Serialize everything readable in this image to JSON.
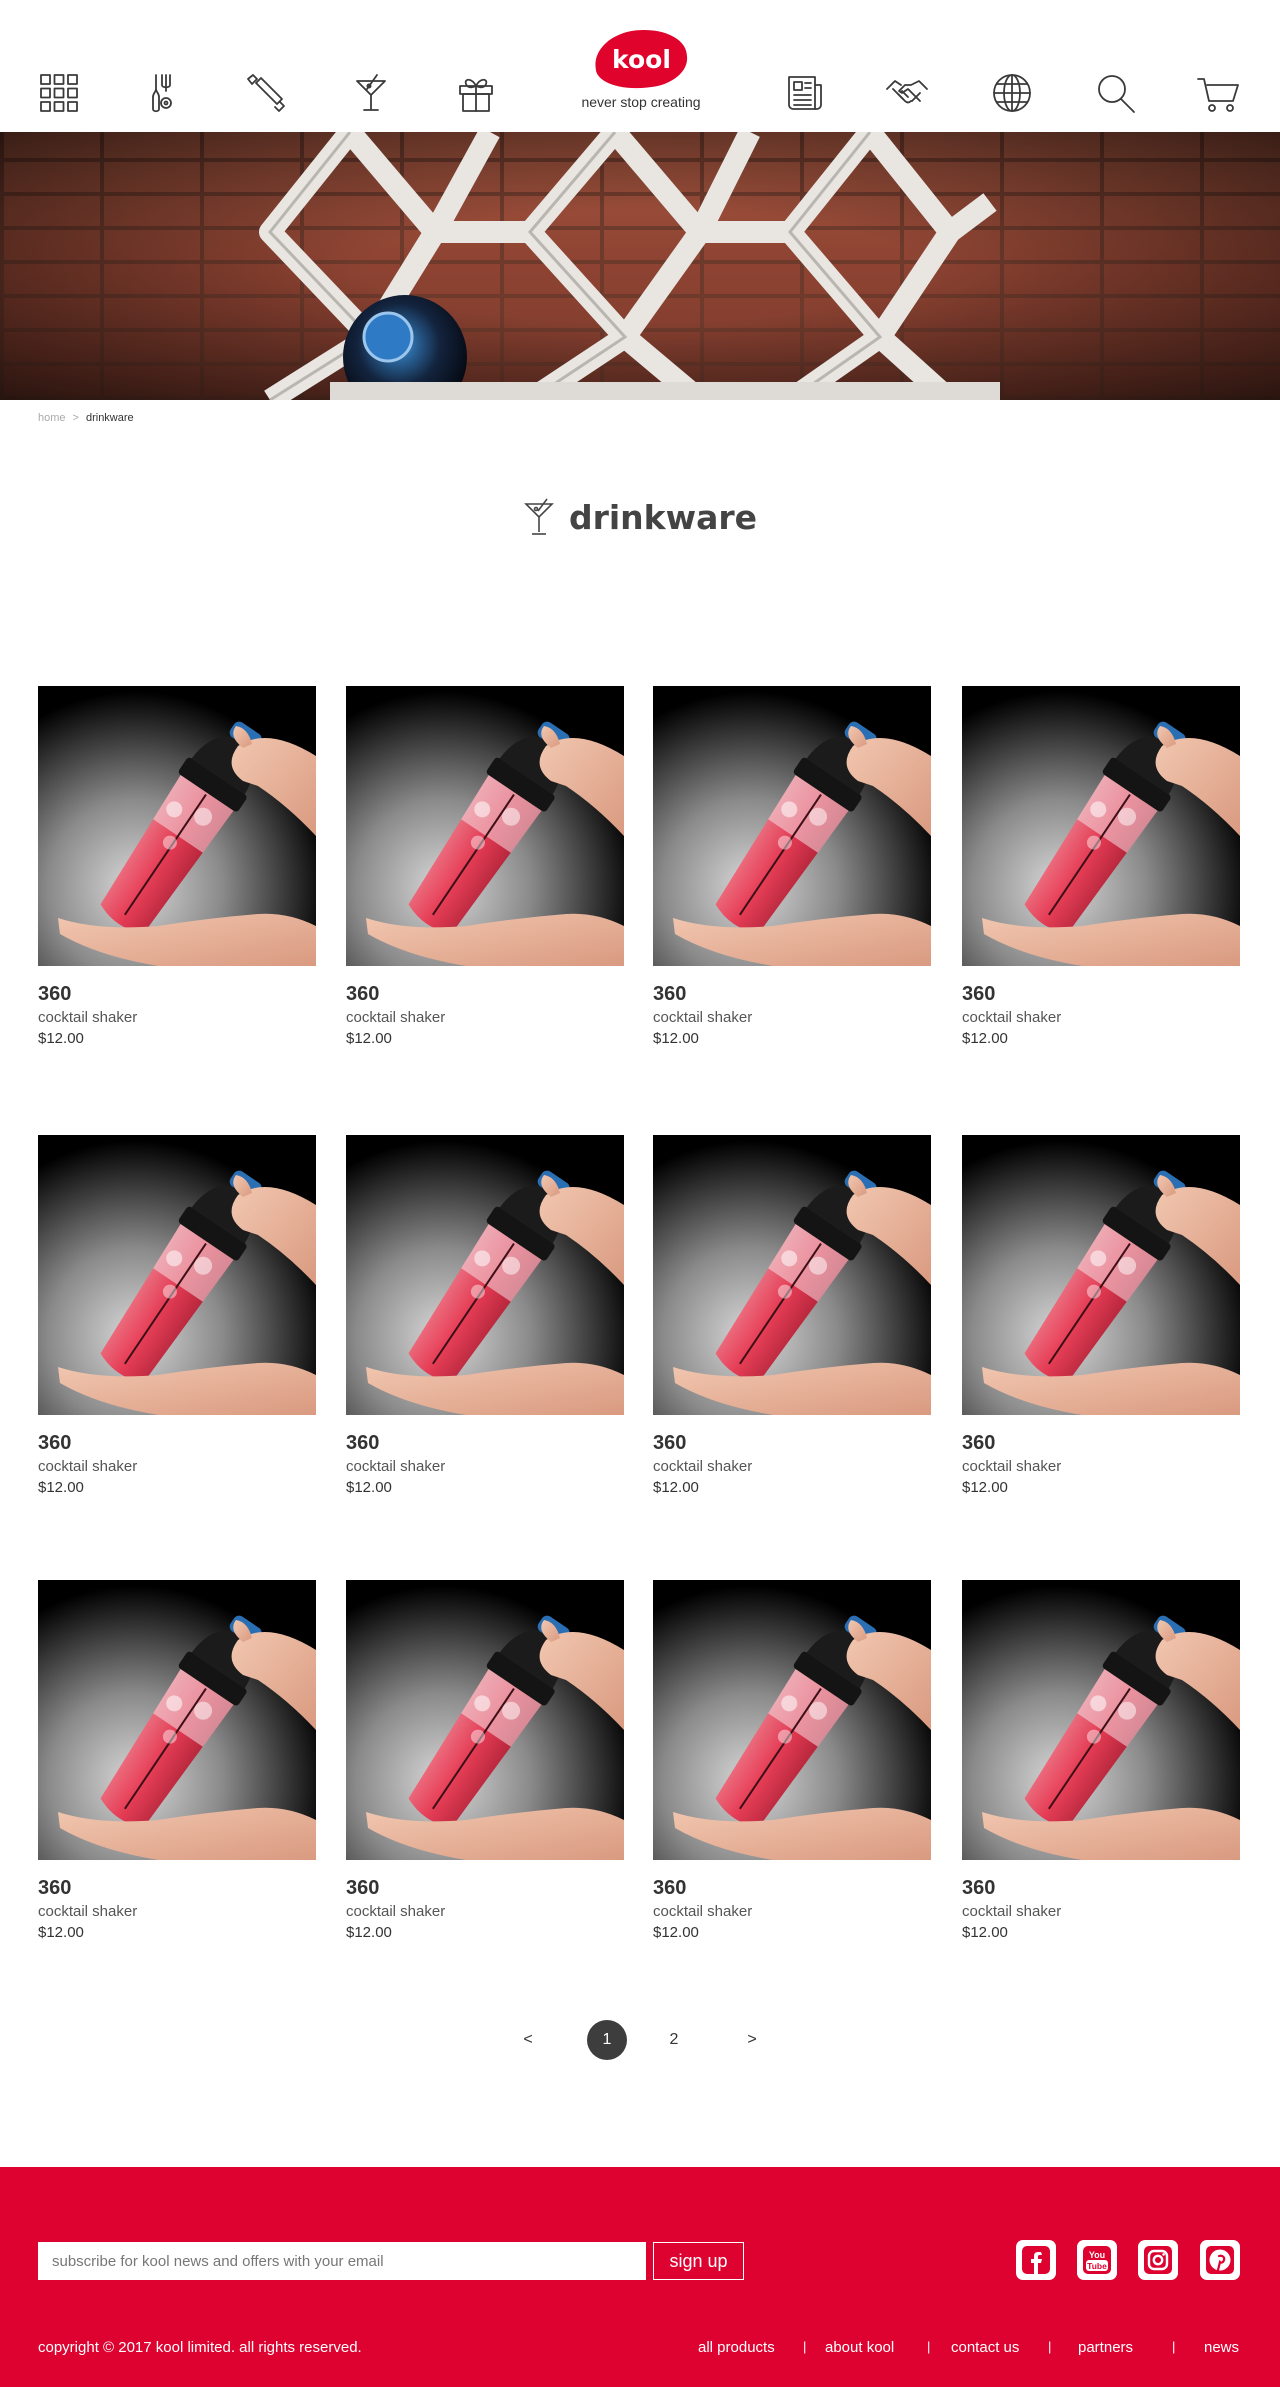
{
  "header": {
    "logo_text": "kool",
    "tagline": "never stop creating",
    "brand_color": "#e0032c",
    "nav_icons": [
      "grid-menu-icon",
      "kitchen-utensils-icon",
      "rolling-pin-icon",
      "cocktail-glass-icon",
      "gift-icon",
      "news-icon",
      "handshake-icon",
      "globe-icon",
      "search-icon",
      "cart-icon"
    ]
  },
  "breadcrumb": {
    "home": "home",
    "separator": ">",
    "current": "drinkware"
  },
  "page": {
    "title": "drinkware",
    "title_icon": "cocktail-glass-icon"
  },
  "products": [
    {
      "name": "360",
      "desc": "cocktail shaker",
      "price": "$12.00"
    },
    {
      "name": "360",
      "desc": "cocktail shaker",
      "price": "$12.00"
    },
    {
      "name": "360",
      "desc": "cocktail shaker",
      "price": "$12.00"
    },
    {
      "name": "360",
      "desc": "cocktail shaker",
      "price": "$12.00"
    },
    {
      "name": "360",
      "desc": "cocktail shaker",
      "price": "$12.00"
    },
    {
      "name": "360",
      "desc": "cocktail shaker",
      "price": "$12.00"
    },
    {
      "name": "360",
      "desc": "cocktail shaker",
      "price": "$12.00"
    },
    {
      "name": "360",
      "desc": "cocktail shaker",
      "price": "$12.00"
    },
    {
      "name": "360",
      "desc": "cocktail shaker",
      "price": "$12.00"
    },
    {
      "name": "360",
      "desc": "cocktail shaker",
      "price": "$12.00"
    },
    {
      "name": "360",
      "desc": "cocktail shaker",
      "price": "$12.00"
    },
    {
      "name": "360",
      "desc": "cocktail shaker",
      "price": "$12.00"
    }
  ],
  "pagination": {
    "prev": "<",
    "pages": [
      "1",
      "2"
    ],
    "current": "1",
    "next": ">"
  },
  "footer": {
    "background": "#de0230",
    "subscribe_placeholder": "subscribe for kool news and offers with your email",
    "signup_label": "sign up",
    "social": [
      "facebook-icon",
      "youtube-icon",
      "instagram-icon",
      "pinterest-icon"
    ],
    "youtube_text": "You Tube",
    "copyright": "copyright © 2017 kool limited. all rights reserved.",
    "links": [
      "all products",
      "about kool",
      "contact us",
      "partners",
      "news"
    ],
    "link_separator": "|"
  }
}
